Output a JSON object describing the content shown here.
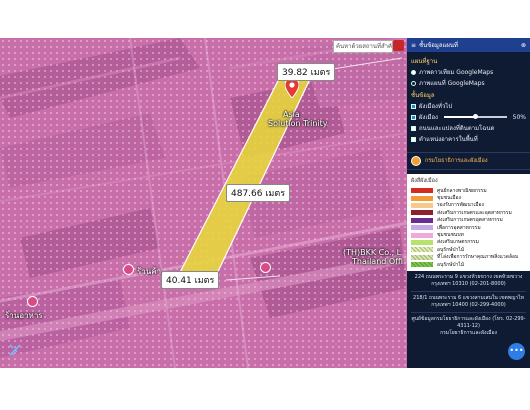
{
  "map": {
    "search_placeholder": "ค้นหาด้วยสถานที่สำคัญ",
    "measurements": {
      "top": "39.82 เมตร",
      "middle": "487.66 เมตร",
      "bottom": "40.41 เมตร"
    },
    "places": {
      "asia": "Asia",
      "solution": "Solution Trinity",
      "bkk": "(TH)BKK Co., L",
      "thailand": "Thailand Offi",
      "poi_center": "ร้านค้า",
      "poi_left": "ร้านอาหาร"
    },
    "colors": {
      "zone_pink": "#c86fa9",
      "strip_yellow": "#e7d83a",
      "marker_red": "#e53935"
    }
  },
  "panel": {
    "header": "ชั้นข้อมูลแผนที่",
    "basemap_title": "แผนที่ฐาน",
    "basemaps": [
      {
        "label": "ภาพดาวเทียม GoogleMaps",
        "selected": true
      },
      {
        "label": "ภาพแผนที่ GoogleMaps",
        "selected": false
      }
    ],
    "layers_title": "ชั้นข้อมูล",
    "layers": [
      {
        "label": "ผังเมืองทั่วไป",
        "checked": true
      },
      {
        "label": "ผังเมือง",
        "checked": true,
        "opacity": "50%"
      },
      {
        "label": "ถนนและแปลงที่ดินตามโฉนด",
        "checked": false
      },
      {
        "label": "ตำแหน่งอาคารในพื้นที่",
        "checked": false
      }
    ],
    "opacity_level": 0.5,
    "department": "กรมโยธาธิการและผังเมือง",
    "legend_title": "ผังสีผังเมือง",
    "legend": [
      {
        "color": "#d52b1e",
        "label": "ศูนย์กลางพาณิชยกรรม",
        "hatch": false
      },
      {
        "color": "#f29b38",
        "label": "ชุมชนเมือง",
        "hatch": false
      },
      {
        "color": "#f6c98f",
        "label": "รองรับการพัฒนาเมือง",
        "hatch": false
      },
      {
        "color": "#8e1f2b",
        "label": "ส่งเสริมการเกษตรและอุตสาหกรรม",
        "hatch": false
      },
      {
        "color": "#6b2c8f",
        "label": "ส่งเสริมการเกษตรอุตสาหกรรม",
        "hatch": false
      },
      {
        "color": "#c8a9e8",
        "label": "เพื่อการอุตสาหกรรม",
        "hatch": false
      },
      {
        "color": "#f2a9d8",
        "label": "ชุมชนชนบท",
        "hatch": false
      },
      {
        "color": "#b6e36b",
        "label": "ส่งเสริมเกษตรกรรม",
        "hatch": false
      },
      {
        "color": "#e0f0b3",
        "label": "อนุรักษ์ป่าไม้",
        "hatch": true
      },
      {
        "color": "#d6e7a8",
        "label": "ที่โล่งเพื่อการรักษาคุณภาพสิ่งแวดล้อม",
        "hatch": true
      },
      {
        "color": "#7bc94b",
        "label": "อนุรักษ์ป่าไม้",
        "hatch": true
      }
    ],
    "address1": "224 ถนนพระราม 9 แขวงห้วยขวาง เขตห้วยขวาง กรุงเทพฯ 10310 (02-201-8000)",
    "address2": "218/1 ถนนพระราม 6 แขวงสามเสนใน เขตพญาไท กรุงเทพฯ 10400 (02-299-4000)",
    "contact": "ศูนย์ข้อมูลกรมโยธาธิการและผังเมือง (โทร. 02-299-4311-12)",
    "footer": "กรมโยธาธิการและผังเมือง"
  }
}
